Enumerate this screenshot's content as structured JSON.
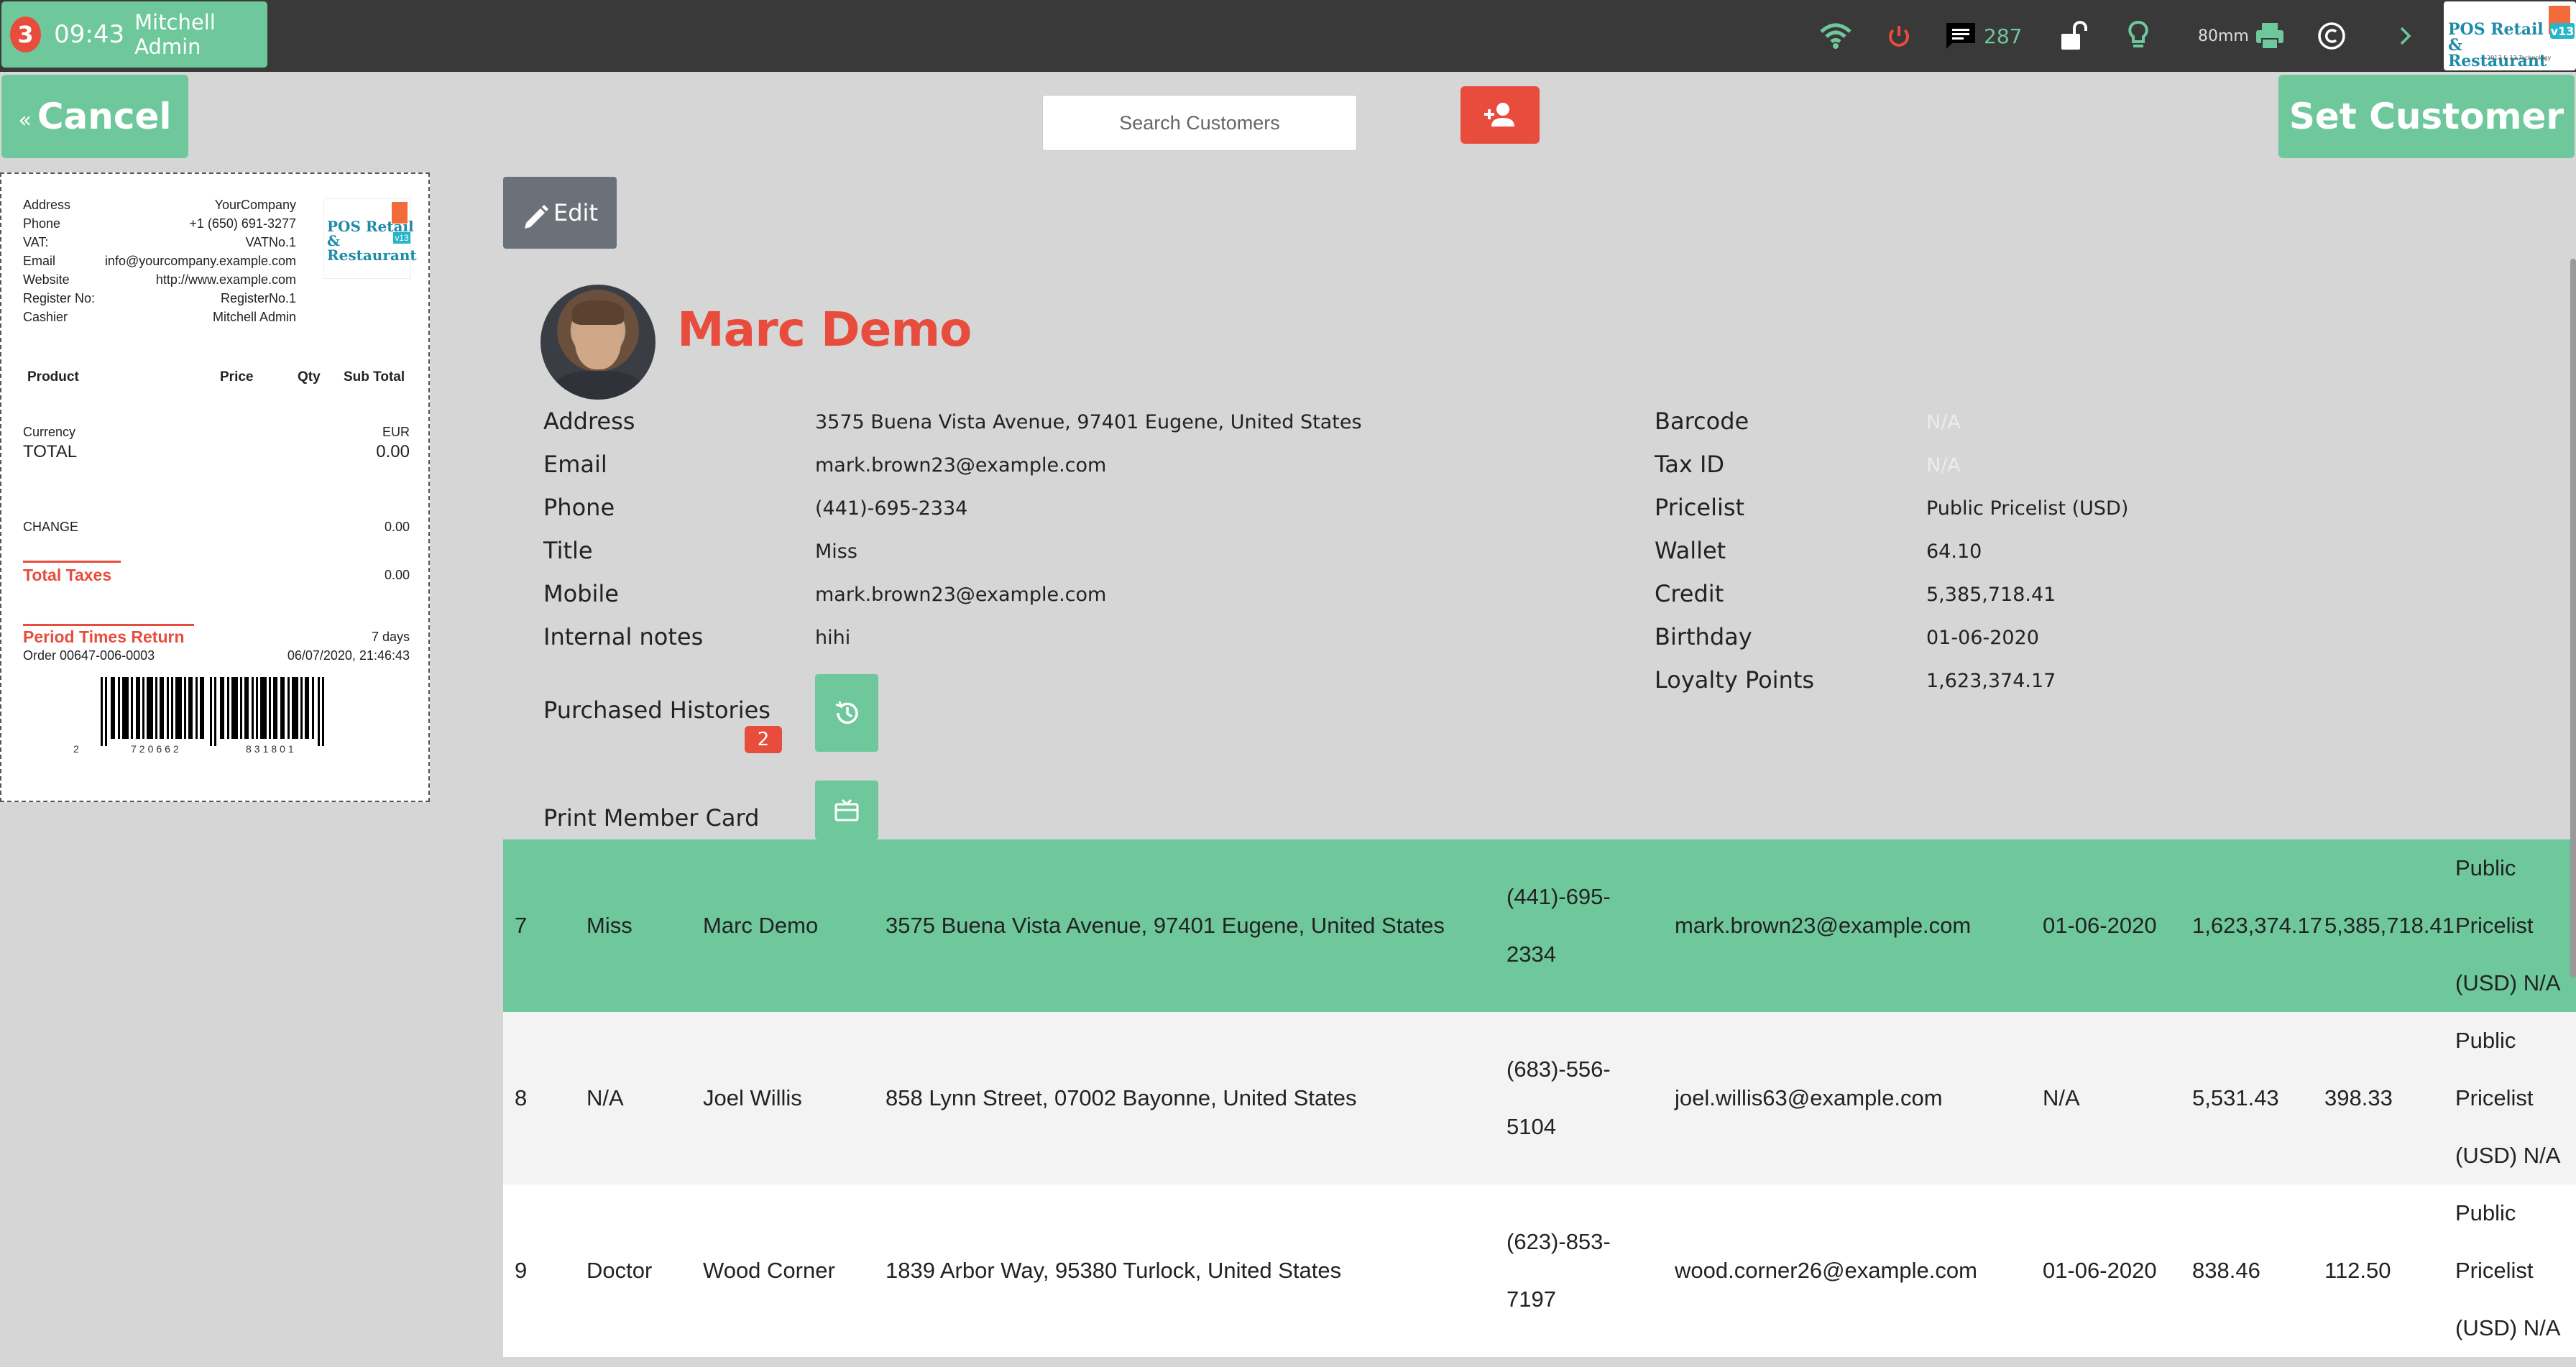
{
  "topbar": {
    "session_number": "3",
    "time": "09:43",
    "user": "Mitchell Admin",
    "message_count": "287",
    "paper_size": "80mm",
    "logo_text": "POS Retail & Restaurant",
    "logo_version": "v13",
    "logo_sub": "2017 & 13 Technology",
    "icons": [
      "wifi-icon",
      "power-icon",
      "message-icon",
      "unlock-icon",
      "lightbulb-icon",
      "printer-icon",
      "copyright-icon",
      "chevron-right-icon"
    ],
    "colors": {
      "wifi": "#6ec89b",
      "power": "#e74c3c",
      "accent": "#6ec89b"
    }
  },
  "header": {
    "cancel_label": "Cancel",
    "cancel_chevron": "«",
    "search_placeholder": "Search Customers",
    "set_customer_label": "Set Customer"
  },
  "receipt": {
    "info": [
      {
        "label": "Address",
        "value": "YourCompany"
      },
      {
        "label": "Phone",
        "value": "+1 (650) 691-3277"
      },
      {
        "label": "VAT:",
        "value": "VATNo.1"
      },
      {
        "label": "Email",
        "value": "info@yourcompany.example.com"
      },
      {
        "label": "Website",
        "value": "http://www.example.com"
      },
      {
        "label": "Register No:",
        "value": "RegisterNo.1"
      },
      {
        "label": "Cashier",
        "value": "Mitchell Admin"
      }
    ],
    "columns": [
      "Product",
      "Price",
      "Qty",
      "Sub Total"
    ],
    "currency_label": "Currency",
    "currency_value": "EUR",
    "total_label": "TOTAL",
    "total_value": "0.00",
    "change_label": "CHANGE",
    "change_value": "0.00",
    "taxes_label": "Total Taxes",
    "taxes_value": "0.00",
    "return_label": "Period Times Return",
    "return_value": "7 days",
    "order_label": "Order 00647-006-0003",
    "order_date": "06/07/2020, 21:46:43",
    "barcode_digits": [
      "2",
      "720662",
      "831801"
    ]
  },
  "detail": {
    "edit_label": "Edit",
    "name": "Marc Demo",
    "left_fields": [
      {
        "label": "Address",
        "value": "3575 Buena Vista Avenue, 97401 Eugene, United States"
      },
      {
        "label": "Email",
        "value": "mark.brown23@example.com"
      },
      {
        "label": "Phone",
        "value": "(441)-695-2334"
      },
      {
        "label": "Title",
        "value": "Miss"
      },
      {
        "label": "Mobile",
        "value": "mark.brown23@example.com"
      },
      {
        "label": "Internal notes",
        "value": "hihi"
      }
    ],
    "right_fields": [
      {
        "label": "Barcode",
        "value": "N/A"
      },
      {
        "label": "Tax ID",
        "value": "N/A"
      },
      {
        "label": "Pricelist",
        "value": "Public Pricelist (USD)"
      },
      {
        "label": "Wallet",
        "value": "64.10"
      },
      {
        "label": "Credit",
        "value": "5,385,718.41"
      },
      {
        "label": "Birthday",
        "value": "01-06-2020"
      },
      {
        "label": "Loyalty Points",
        "value": "1,623,374.17"
      }
    ],
    "purchased_histories_label": "Purchased Histories",
    "purchased_histories_count": "2",
    "print_member_card_label": "Print Member Card"
  },
  "table": {
    "rows": [
      {
        "id": "7",
        "title": "Miss",
        "name": "Marc Demo",
        "address": "3575 Buena Vista Avenue, 97401 Eugene, United States",
        "phone": "(441)-695-2334",
        "email": "mark.brown23@example.com",
        "birthday": "01-06-2020",
        "loyalty": "1,623,374.17",
        "credit": "5,385,718.41",
        "pricelist": "Public Pricelist (USD) N/A",
        "selected": true
      },
      {
        "id": "8",
        "title": "N/A",
        "name": "Joel Willis",
        "address": "858 Lynn Street, 07002 Bayonne, United States",
        "phone": "(683)-556-5104",
        "email": "joel.willis63@example.com",
        "birthday": "N/A",
        "loyalty": "5,531.43",
        "credit": "398.33",
        "pricelist": "Public Pricelist (USD) N/A",
        "selected": false
      },
      {
        "id": "9",
        "title": "Doctor",
        "name": "Wood Corner",
        "address": "1839 Arbor Way, 95380 Turlock, United States",
        "phone": "(623)-853-7197",
        "email": "wood.corner26@example.com",
        "birthday": "01-06-2020",
        "loyalty": "838.46",
        "credit": "112.50",
        "pricelist": "Public Pricelist (USD) N/A",
        "selected": false
      }
    ]
  }
}
